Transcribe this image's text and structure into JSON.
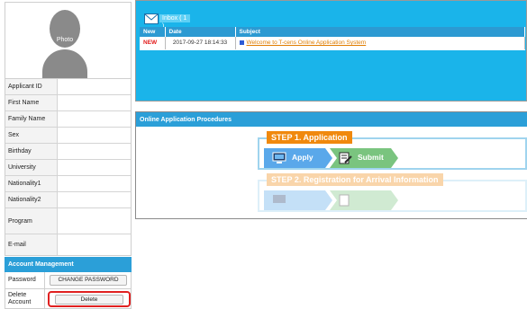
{
  "profile": {
    "photo_label": "Photo",
    "fields": [
      {
        "label": "Applicant ID"
      },
      {
        "label": "First Name"
      },
      {
        "label": "Family Name"
      },
      {
        "label": "Sex"
      },
      {
        "label": "Birthday"
      },
      {
        "label": "University"
      },
      {
        "label": "Nationality1"
      },
      {
        "label": "Nationality2"
      },
      {
        "label": "Program"
      },
      {
        "label": "E-mail"
      }
    ]
  },
  "account": {
    "header": "Account Management",
    "password_label": "Password",
    "change_password_button": "CHANGE PASSWORD",
    "delete_label": "Delete Account",
    "delete_button": "Delete"
  },
  "inbox": {
    "tab_label": "Inbox ( 1 )",
    "columns": [
      "New",
      "Date",
      "Subject"
    ],
    "messages": [
      {
        "new": "NEW",
        "date": "2017-09-27 18:14:33",
        "subject": "Welcome to T-cens Online Application System"
      }
    ]
  },
  "procedures": {
    "header": "Online Application Procedures",
    "step1": {
      "label": "STEP 1. Application",
      "apply": "Apply",
      "submit": "Submit"
    },
    "step2": {
      "label": "STEP 2. Registration for Arrival Information"
    }
  },
  "colors": {
    "accent": "#2b9fd8",
    "inbox_bg": "#1ab4ea",
    "step_orange": "#f0890e",
    "apply_blue": "#5aa8ea",
    "submit_green": "#7ac47f",
    "highlight_red": "#e02020"
  }
}
